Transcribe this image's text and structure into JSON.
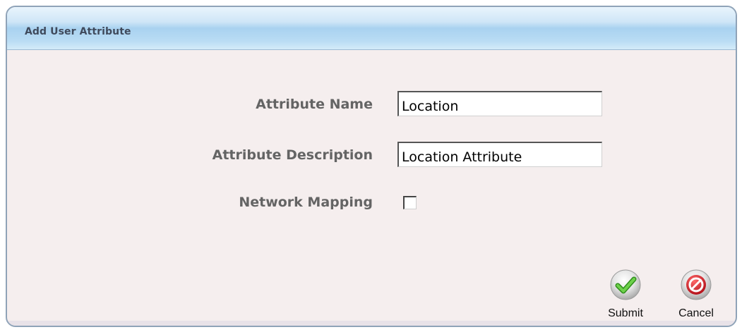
{
  "dialog": {
    "title": "Add User Attribute"
  },
  "form": {
    "attribute_name": {
      "label": "Attribute Name",
      "value": "Location"
    },
    "attribute_description": {
      "label": "Attribute Description",
      "value": "Location Attribute"
    },
    "network_mapping": {
      "label": "Network Mapping",
      "checked": false
    }
  },
  "actions": {
    "submit": {
      "label": "Submit",
      "icon": "checkmark-icon",
      "color": "#4caf2e"
    },
    "cancel": {
      "label": "Cancel",
      "icon": "no-entry-icon",
      "color": "#d9262c"
    }
  }
}
